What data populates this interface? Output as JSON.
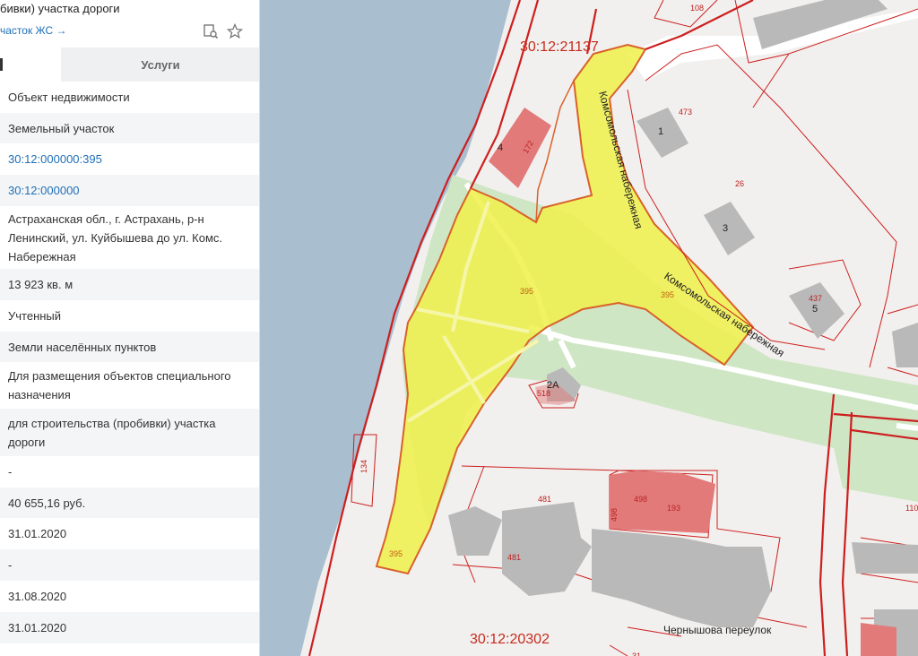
{
  "panel": {
    "title": "бивки) участка дороги",
    "link": "часток ЖС →",
    "tabs": {
      "first": "",
      "services": "Услуги"
    },
    "rows": [
      "Объект недвижимости",
      "Земельный участок",
      "30:12:000000:395",
      "30:12:000000",
      "Астраханская обл., г. Астрахань, р-н Ленинский, ул. Куйбышева до ул. Комс. Набережная",
      "13 923 кв. м",
      "Учтенный",
      "Земли населённых пунктов",
      "Для размещения объектов специального назначения",
      "для строительства (пробивки) участка дороги",
      "-",
      "40 655,16 руб.",
      "31.01.2020",
      "-",
      "31.08.2020",
      "31.01.2020"
    ]
  },
  "map": {
    "colors": {
      "water": "#a9bfd0",
      "parcel_highlight": "#f0f04a",
      "parcel_border": "#d9612a",
      "boundary": "#cc1f1f",
      "building_red": "#e27a7a",
      "building_gray": "#b9b9b9",
      "green": "#cfe6c5"
    },
    "block_labels": {
      "top": "30:12:21137",
      "bottom": "30:12:20302"
    },
    "street_labels": {
      "naberezhnaya_1": "Комсомольская набережная",
      "naberezhnaya_2": "Комсомольская набережная",
      "pereulok": "Чернышова переулок"
    },
    "parcel_numbers": {
      "p108": "108",
      "p473": "473",
      "p26": "26",
      "p437": "437",
      "p395a": "395",
      "p395b": "395",
      "p395c": "395",
      "p518": "518",
      "p481a": "481",
      "p481b": "481",
      "p498a": "498",
      "p498b": "498",
      "p193": "193",
      "p134": "134",
      "p110": "110",
      "p172": "172",
      "p2a": "2А",
      "p1": "1",
      "p3": "3",
      "p4": "4",
      "p5": "5",
      "p31": "31"
    }
  }
}
